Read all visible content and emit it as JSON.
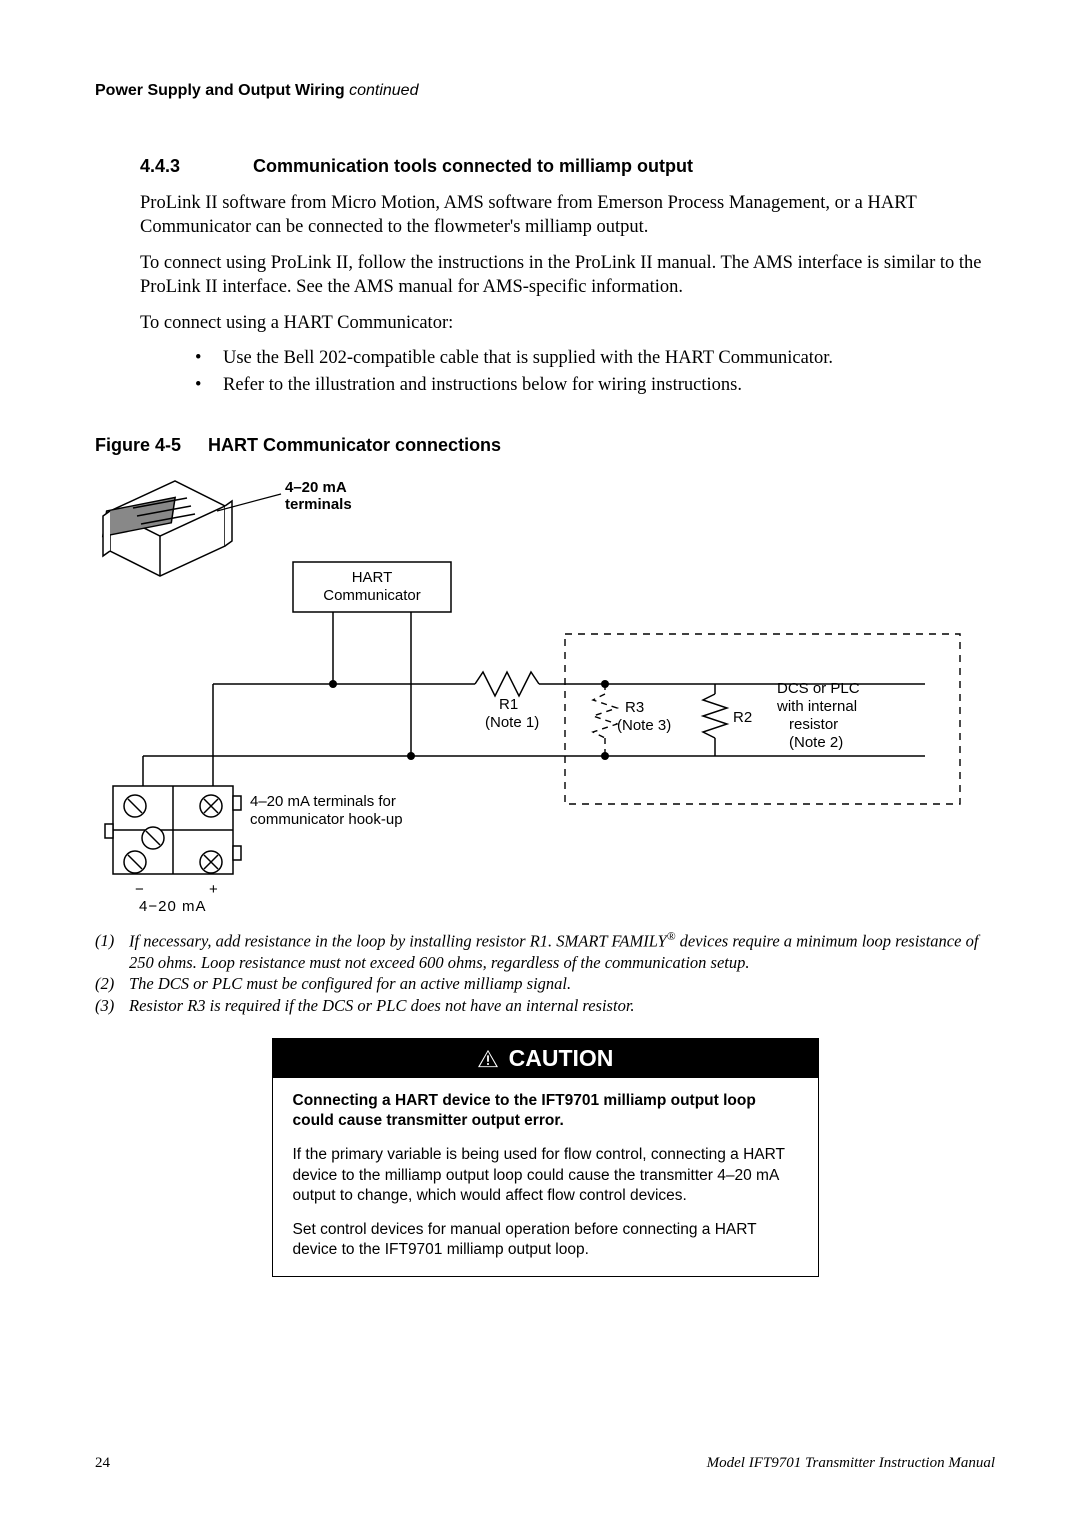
{
  "header": {
    "title": "Power Supply and Output Wiring",
    "continued": "continued"
  },
  "section": {
    "number": "4.4.3",
    "title": "Communication tools connected to milliamp output"
  },
  "paragraphs": {
    "p1": "ProLink II software from Micro Motion, AMS software from Emerson Process Management, or a HART Communicator can be connected to the flowmeter's milliamp output.",
    "p2": "To connect using ProLink II, follow the instructions in the ProLink II manual. The AMS interface is similar to the ProLink II interface. See the AMS manual for AMS-specific information.",
    "p3": "To connect using a HART Communicator:"
  },
  "bullets": {
    "b1": "Use the Bell 202-compatible cable that is supplied with the HART Communicator.",
    "b2": "Refer to the illustration and instructions below for wiring instructions."
  },
  "figure": {
    "number": "Figure 4-5",
    "title": "HART Communicator connections",
    "labels": {
      "terminals": "4–20 mA terminals",
      "hart_box": "HART Communicator",
      "r1": "R1",
      "r1_note": "(Note 1)",
      "r3": "R3",
      "r3_note": "(Note 3)",
      "r2": "R2",
      "dcs_line1": "DCS or PLC",
      "dcs_line2": "with internal",
      "dcs_line3": "resistor",
      "dcs_line4": "(Note 2)",
      "hookup": "4–20 mA terminals for communicator hook-up",
      "minus": "−",
      "plus": "+",
      "ma": "4−20  mA"
    }
  },
  "notes": {
    "n1_num": "(1)",
    "n1": "If necessary, add resistance in the loop by installing resistor R1. SMART FAMILY",
    "n1_suffix": " devices require a minimum loop resistance of 250 ohms. Loop resistance must not exceed 600 ohms, regardless of the communication setup.",
    "n2_num": "(2)",
    "n2": "The DCS or PLC must be configured for an active milliamp signal.",
    "n3_num": "(3)",
    "n3": "Resistor R3 is required if the DCS or PLC does not have an internal resistor."
  },
  "caution": {
    "header": "CAUTION",
    "lead": "Connecting a HART device to the IFT9701 milliamp output loop could cause transmitter output error.",
    "p1": "If the primary variable is being used for flow control, connecting a HART device to the milliamp output loop could cause the transmitter 4–20 mA output to change, which would affect flow control devices.",
    "p2": "Set control devices for manual operation before connecting a HART device to the IFT9701 milliamp output loop."
  },
  "footer": {
    "page": "24",
    "manual": "Model IFT9701 Transmitter Instruction Manual"
  }
}
